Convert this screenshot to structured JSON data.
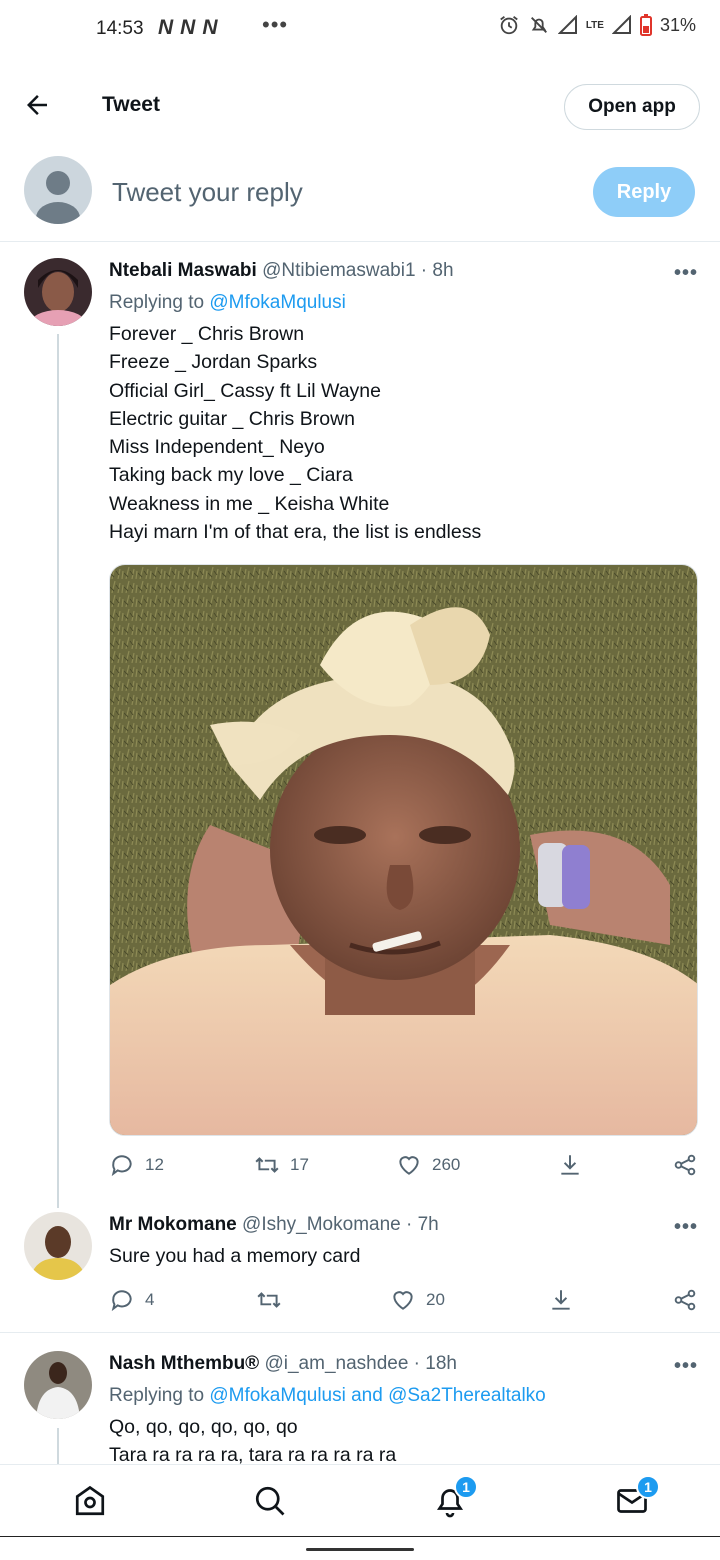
{
  "status_bar": {
    "time": "14:53",
    "n_icon": "N",
    "dots": "•••",
    "lte": "LTE",
    "battery": "31%"
  },
  "header": {
    "title": "Tweet",
    "open_app": "Open app"
  },
  "composer": {
    "placeholder": "Tweet your reply",
    "reply_button": "Reply"
  },
  "tweets": [
    {
      "name": "Ntebali Maswabi",
      "handle_time": "@Ntibiemaswabi1 · 8h",
      "replying_prefix": "Replying to",
      "replying_to": "@MfokaMqulusi",
      "lines": [
        "Forever _ Chris Brown",
        "Freeze _ Jordan Sparks",
        "Official Girl_ Cassy ft Lil Wayne",
        "Electric guitar _ Chris Brown",
        "Miss Independent_ Neyo",
        "Taking back my love _ Ciara",
        "Weakness in me _ Keisha White",
        "Hayi marn I'm of that era, the list is endless"
      ],
      "replies": "12",
      "retweets": "17",
      "likes": "260"
    },
    {
      "name": "Mr Mokomane",
      "handle_time": "@Ishy_Mokomane · 7h",
      "text": "Sure you had a memory card",
      "replies": "4",
      "likes": "20"
    },
    {
      "name": "Nash Mthembu®",
      "handle_time": "@i_am_nashdee · 18h",
      "replying_prefix": "Replying to",
      "replying_to": "@MfokaMqulusi and @Sa2Therealtalko",
      "lines": [
        "Qo, qo, qo, qo, qo, qo",
        "Tara ra ra ra ra, tara ra ra ra ra ra"
      ]
    }
  ],
  "icons": {
    "more": "•••",
    "reply": "reply-icon",
    "retweet": "retweet-icon",
    "like": "heart-icon",
    "save": "download-icon",
    "share": "share-icon"
  },
  "bottom_nav": {
    "notifications_badge": "1",
    "messages_badge": "1"
  },
  "colors": {
    "accent": "#1d9bf0",
    "reply_button_disabled": "#8ecdf8",
    "secondary_text": "#536471"
  }
}
